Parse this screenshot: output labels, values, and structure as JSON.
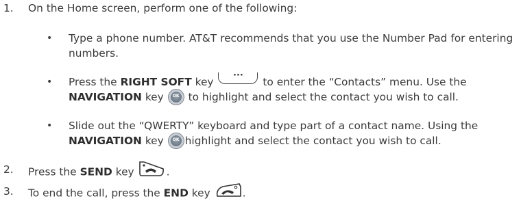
{
  "steps": [
    {
      "number": "1.",
      "text": "On the Home screen, perform one of the following:"
    },
    {
      "number": "2.",
      "pre": "Press the ",
      "key": "SEND",
      "post": " key"
    },
    {
      "number": "3.",
      "pre": "To end the call, press the ",
      "key": "END",
      "post": " key"
    }
  ],
  "bullets": [
    {
      "line1": "Type a phone number. AT&T recommends that you use the Number Pad for entering",
      "line2": "numbers."
    },
    {
      "line1_pre": "Press the ",
      "line1_key": "RIGHT SOFT",
      "line1_mid": " key",
      "softkey_glyph": "···",
      "line1_post": " to enter the “Contacts” menu. Use the",
      "line2_key": "NAVIGATION",
      "line2_mid": " key",
      "line2_post": " to highlight and select the contact you wish to call."
    },
    {
      "line1": "Slide out the “QWERTY” keyboard and type part of a contact name. Using the",
      "line2_key": "NAVIGATION",
      "line2_mid": " key",
      "line2_post": "highlight and select the contact you wish to call."
    }
  ],
  "bullet_glyph": "•",
  "icons": [
    "right-soft-key-icon",
    "navigation-key-icon",
    "send-key-icon",
    "end-key-icon"
  ],
  "step_end_punct": "."
}
